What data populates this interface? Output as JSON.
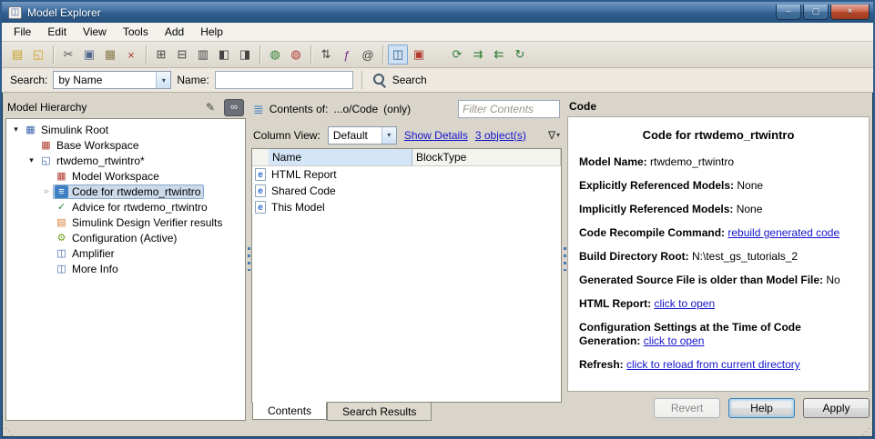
{
  "window": {
    "title": "Model Explorer",
    "app_icon_glyph": "◫",
    "controls": {
      "minimize": "–",
      "maximize": "▢",
      "close": "×"
    }
  },
  "menu": {
    "items": [
      "File",
      "Edit",
      "View",
      "Tools",
      "Add",
      "Help"
    ]
  },
  "toolbar": {
    "groups": [
      {
        "icons": [
          {
            "name": "new-model-icon",
            "glyph": "▤",
            "color": "#c9a227"
          },
          {
            "name": "open-icon",
            "glyph": "◱",
            "color": "#d4a017"
          }
        ]
      },
      {
        "icons": [
          {
            "name": "cut-icon",
            "glyph": "✂",
            "color": "#555555"
          },
          {
            "name": "copy-icon",
            "glyph": "▣",
            "color": "#55688c"
          },
          {
            "name": "paste-icon",
            "glyph": "▦",
            "color": "#8a7b4a"
          },
          {
            "name": "delete-icon",
            "glyph": "×",
            "color": "#b03a2e"
          }
        ]
      },
      {
        "icons": [
          {
            "name": "expand-all-icon",
            "glyph": "⊞",
            "color": "#444444"
          },
          {
            "name": "collapse-all-icon",
            "glyph": "⊟",
            "color": "#444444"
          },
          {
            "name": "list-view-icon",
            "glyph": "▥",
            "color": "#444444"
          },
          {
            "name": "split-left-icon",
            "glyph": "◧",
            "color": "#444444"
          },
          {
            "name": "split-right-icon",
            "glyph": "◨",
            "color": "#444444"
          }
        ]
      },
      {
        "icons": [
          {
            "name": "web-green-icon",
            "glyph": "◍",
            "color": "#2e7d32"
          },
          {
            "name": "web-red-icon",
            "glyph": "◍",
            "color": "#b03a2e"
          }
        ]
      },
      {
        "icons": [
          {
            "name": "sort-icon",
            "glyph": "⇅",
            "color": "#444444"
          },
          {
            "name": "function-icon",
            "glyph": "ƒ",
            "color": "#7a2e8d"
          },
          {
            "name": "at-icon",
            "glyph": "@",
            "color": "#444444"
          }
        ]
      },
      {
        "icons": [
          {
            "name": "column-view-toggle-icon",
            "glyph": "◫",
            "color": "#2e5a88",
            "pressed": true
          },
          {
            "name": "dialog-pane-icon",
            "glyph": "▣",
            "color": "#b03a2e"
          }
        ]
      },
      {
        "gap": true,
        "icons": [
          {
            "name": "update-diagram-icon",
            "glyph": "⟳",
            "color": "#2e7d32"
          },
          {
            "name": "propagate-icon",
            "glyph": "⇉",
            "color": "#2e7d32"
          },
          {
            "name": "revert-changes-icon",
            "glyph": "⇇",
            "color": "#2e7d32"
          },
          {
            "name": "refresh-icon",
            "glyph": "↻",
            "color": "#2e7d32"
          }
        ]
      }
    ]
  },
  "search_bar": {
    "search_label": "Search:",
    "type_value": "by Name",
    "name_label": "Name:",
    "name_value": "",
    "button_label": "Search"
  },
  "hierarchy": {
    "title": "Model Hierarchy",
    "pencil_icon_glyph": "✎",
    "glasses_icon_glyph": "∞",
    "items": [
      {
        "label": "Simulink Root",
        "level": 0,
        "icon": "simulink-root-icon",
        "expander": "open"
      },
      {
        "label": "Base Workspace",
        "level": 1,
        "icon": "base-workspace-icon",
        "expander": "none"
      },
      {
        "label": "rtwdemo_rtwintro*",
        "level": 1,
        "icon": "model-icon",
        "expander": "open"
      },
      {
        "label": "Model Workspace",
        "level": 2,
        "icon": "model-workspace-icon",
        "expander": "none"
      },
      {
        "label": "Code for rtwdemo_rtwintro",
        "level": 2,
        "icon": "code-icon",
        "expander": "closed",
        "selected": true
      },
      {
        "label": "Advice for rtwdemo_rtwintro",
        "level": 2,
        "icon": "advice-icon",
        "expander": "none"
      },
      {
        "label": "Simulink Design Verifier results",
        "level": 2,
        "icon": "sldv-icon",
        "expander": "none"
      },
      {
        "label": "Configuration (Active)",
        "level": 2,
        "icon": "config-icon",
        "expander": "none"
      },
      {
        "label": "Amplifier",
        "level": 2,
        "icon": "block-icon",
        "expander": "none"
      },
      {
        "label": "More Info",
        "level": 2,
        "icon": "block-icon",
        "expander": "none"
      }
    ]
  },
  "icons": {
    "simulink-root-icon": {
      "glyph": "▦",
      "color": "#3a62a8"
    },
    "base-workspace-icon": {
      "glyph": "▦",
      "color": "#b03a2e"
    },
    "model-icon": {
      "glyph": "◱",
      "color": "#3a62a8"
    },
    "model-workspace-icon": {
      "glyph": "▦",
      "color": "#b03a2e"
    },
    "code-icon": {
      "glyph": "≡",
      "color": "#ffffff",
      "bg": "#3f7fc4"
    },
    "advice-icon": {
      "glyph": "✓",
      "color": "#2e8b2e"
    },
    "sldv-icon": {
      "glyph": "▤",
      "color": "#d87a2e"
    },
    "config-icon": {
      "glyph": "⚙",
      "color": "#6aa121"
    },
    "block-icon": {
      "glyph": "◫",
      "color": "#3a62a8"
    },
    "e-doc-icon": {
      "glyph": "e",
      "color": "#2a6bd4"
    },
    "contents-icon": {
      "glyph": "≣",
      "color": "#3f7fc4"
    }
  },
  "contents": {
    "title_label": "Contents of:",
    "title_path": "...o/Code",
    "title_only": "(only)",
    "filter_placeholder": "Filter Contents",
    "column_view_label": "Column View:",
    "column_view_value": "Default",
    "show_details_label": "Show Details",
    "objects_label": "3 object(s)",
    "filter_icon_glyph": "∇",
    "columns": [
      "Name",
      "BlockType"
    ],
    "rows": [
      {
        "name": "HTML Report",
        "blocktype": ""
      },
      {
        "name": "Shared Code",
        "blocktype": ""
      },
      {
        "name": "This Model",
        "blocktype": ""
      }
    ],
    "tabs": [
      "Contents",
      "Search Results"
    ],
    "active_tab": 0
  },
  "detail": {
    "panel_title": "Code",
    "heading": "Code for rtwdemo_rtwintro",
    "fields": [
      {
        "label": "Model Name:",
        "value": "rtwdemo_rtwintro",
        "link": false
      },
      {
        "label": "Explicitly Referenced Models:",
        "value": "None",
        "link": false
      },
      {
        "label": "Implicitly Referenced Models:",
        "value": "None",
        "link": false
      },
      {
        "label": "Code Recompile Command:",
        "value": "rebuild generated code",
        "link": true
      },
      {
        "label": "Build Directory Root:",
        "value": "N:\\test_gs_tutorials_2",
        "link": false
      },
      {
        "label": "Generated Source File is older than Model File:",
        "value": "No",
        "link": false
      },
      {
        "label": "HTML Report:",
        "value": "click to open",
        "link": true
      },
      {
        "label": "Configuration Settings at the Time of Code Generation:",
        "value": "click to open",
        "link": true
      },
      {
        "label": "Refresh:",
        "value": "click to reload from current directory",
        "link": true
      }
    ],
    "buttons": [
      {
        "label": "Revert",
        "disabled": true
      },
      {
        "label": "Help",
        "default": true
      },
      {
        "label": "Apply"
      }
    ]
  },
  "colors": {
    "link": "#1414cc",
    "selection_bg": "#ccdaea",
    "selection_border": "#86a7cc",
    "titlebar_top": "#7598c0",
    "titlebar_bottom": "#27527f",
    "close_button": "#b44629"
  }
}
